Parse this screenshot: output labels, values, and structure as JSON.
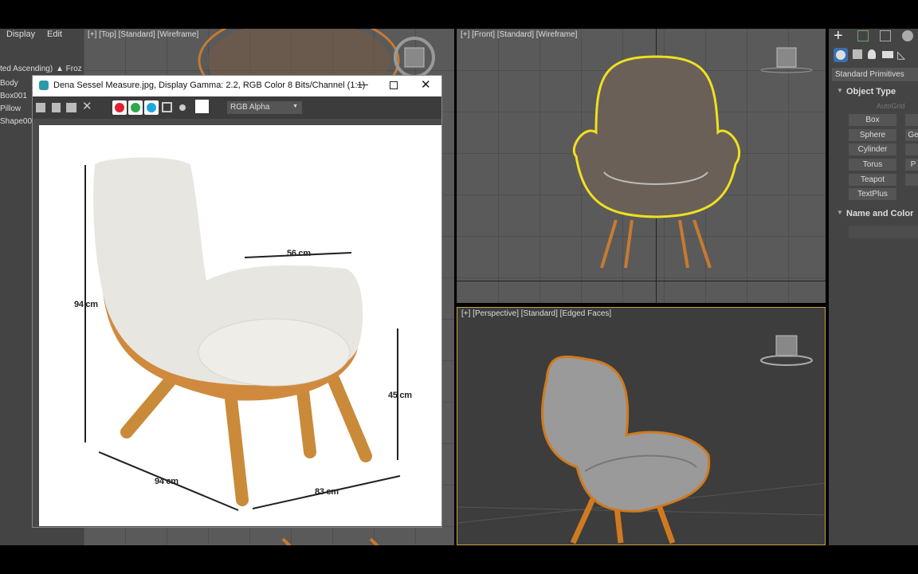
{
  "menu": {
    "display": "Display",
    "edit": "Edit"
  },
  "scene_explorer": {
    "sort_header": "ted Ascending)",
    "frozen_header": "▲ Froz",
    "items": [
      "Body",
      "Box001",
      "Pillow",
      "Shape00"
    ]
  },
  "viewports": {
    "top": "[+] [Top] [Standard] [Wireframe]",
    "front": "[+] [Front] [Standard] [Wireframe]",
    "perspective": "[+] [Perspective] [Standard] [Edged Faces]"
  },
  "image_window": {
    "title": "Dena Sessel Measure.jpg, Display Gamma: 2.2, RGB Color 8 Bits/Channel (1:1)",
    "channel_select": "RGB Alpha",
    "channel_colors": {
      "red": "#e02030",
      "green": "#2ea84a",
      "blue": "#1ea8e0"
    },
    "dimensions": {
      "height": "94 cm",
      "depth": "94 cm",
      "width": "83 cm",
      "arm_width": "56 cm",
      "seat_height": "45 cm"
    }
  },
  "command_panel": {
    "category": "Standard Primitives",
    "object_type_header": "Object Type",
    "autogrid": "AutoGrid",
    "buttons": [
      "Box",
      "Sphere",
      "Cylinder",
      "Torus",
      "Teapot",
      "TextPlus"
    ],
    "buttons_col2": [
      "",
      "Ge",
      "",
      "P",
      "",
      ""
    ],
    "name_color_header": "Name and Color"
  },
  "colors": {
    "selection": "#f0e020",
    "wire": "#d07a20",
    "active_border": "#c8a040"
  }
}
